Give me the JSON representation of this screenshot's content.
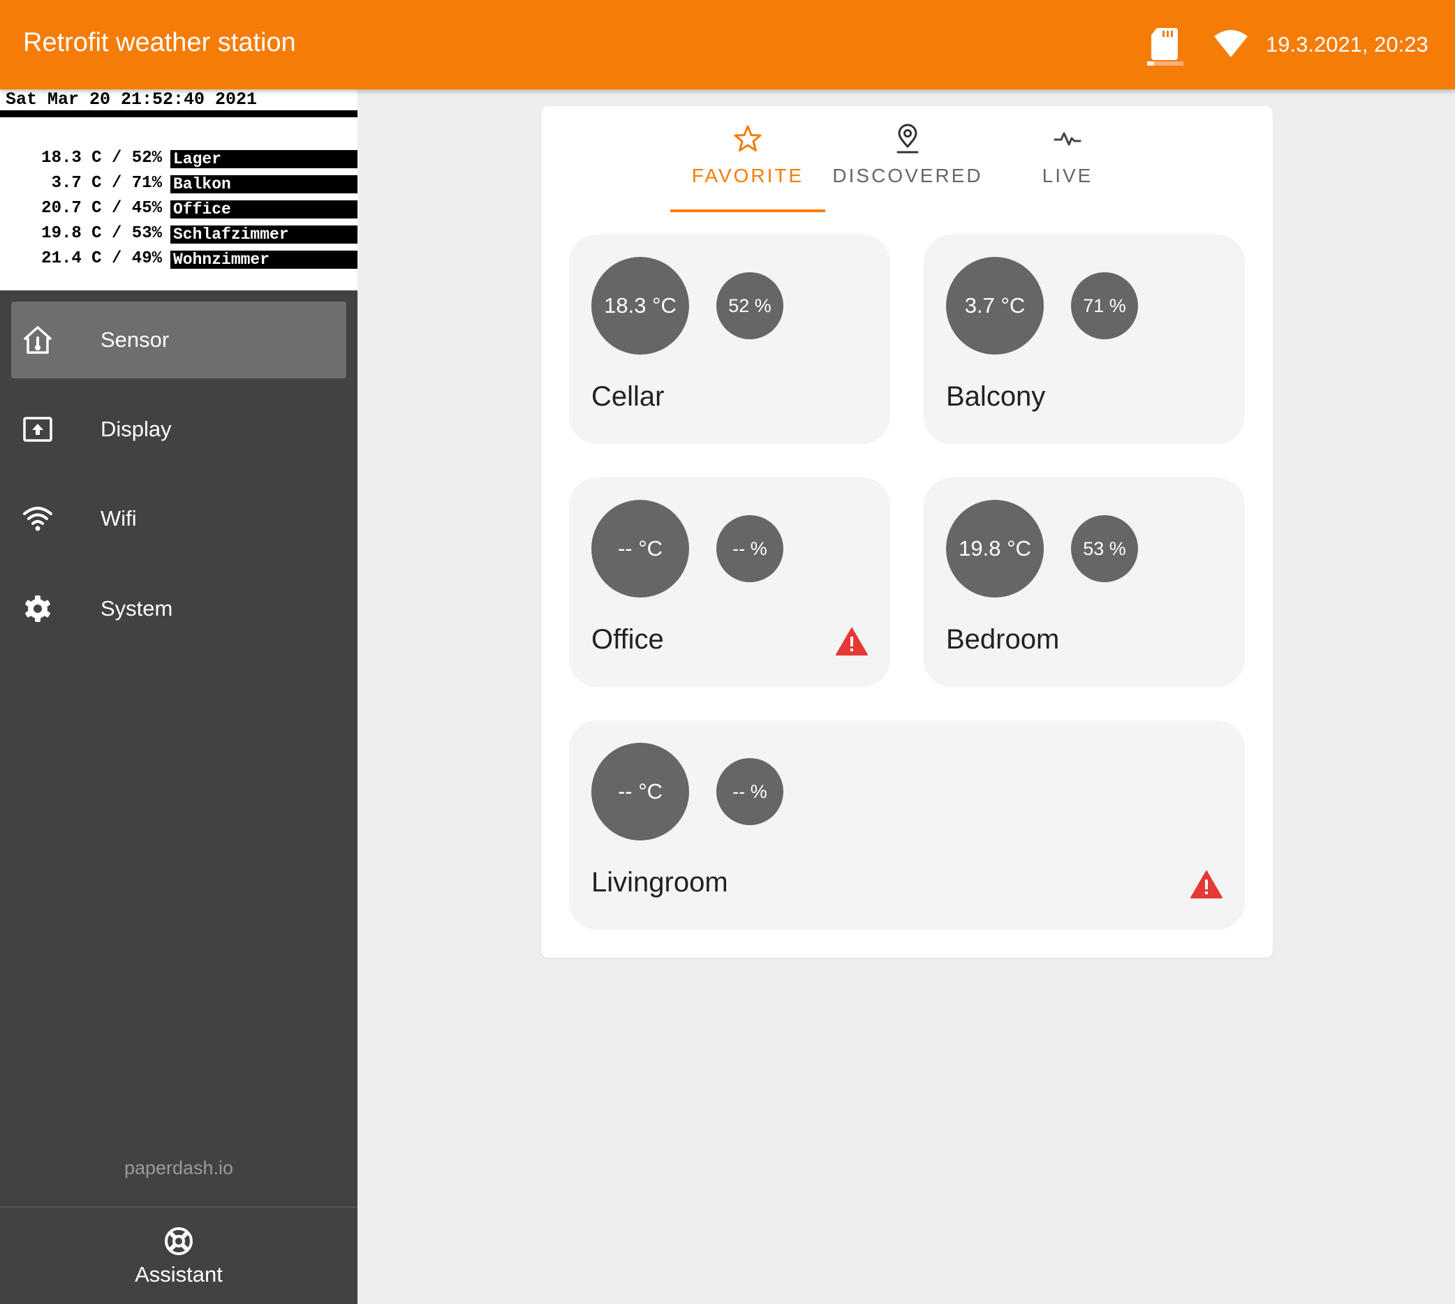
{
  "header": {
    "title": "Retrofit weather station",
    "datetime": "19.3.2021, 20:23",
    "sd_icon": "sd-card-icon",
    "wifi_icon": "wifi-icon",
    "bg_color": "#f57c07"
  },
  "eink_preview": {
    "datetime": "Sat Mar 20 21:52:40 2021",
    "rows": [
      {
        "reading": "18.3 C / 52%",
        "label": "Lager"
      },
      {
        "reading": "3.7 C / 71%",
        "label": "Balkon"
      },
      {
        "reading": "20.7 C / 45%",
        "label": "Office"
      },
      {
        "reading": "19.8 C / 53%",
        "label": "Schlafzimmer"
      },
      {
        "reading": "21.4 C / 49%",
        "label": "Wohnzimmer"
      }
    ]
  },
  "sidebar": {
    "items": [
      {
        "label": "Sensor",
        "icon": "home-thermometer-icon",
        "active": true
      },
      {
        "label": "Display",
        "icon": "display-upload-icon",
        "active": false
      },
      {
        "label": "Wifi",
        "icon": "wifi-icon",
        "active": false
      },
      {
        "label": "System",
        "icon": "gear-icon",
        "active": false
      }
    ],
    "brand": "paperdash.io",
    "assistant": {
      "label": "Assistant",
      "icon": "lifebuoy-icon"
    }
  },
  "tabs": [
    {
      "label": "FAVORITE",
      "icon": "star-icon",
      "active": true
    },
    {
      "label": "DISCOVERED",
      "icon": "map-marker-icon",
      "active": false
    },
    {
      "label": "LIVE",
      "icon": "pulse-icon",
      "active": false
    }
  ],
  "sensors": [
    {
      "name": "Cellar",
      "temperature": "18.3 °C",
      "humidity": "52 %",
      "warning": false
    },
    {
      "name": "Balcony",
      "temperature": "3.7 °C",
      "humidity": "71 %",
      "warning": false
    },
    {
      "name": "Office",
      "temperature": "-- °C",
      "humidity": "-- %",
      "warning": true
    },
    {
      "name": "Bedroom",
      "temperature": "19.8 °C",
      "humidity": "53 %",
      "warning": false
    },
    {
      "name": "Livingroom",
      "temperature": "-- °C",
      "humidity": "-- %",
      "warning": true
    }
  ],
  "colors": {
    "accent": "#f57c07",
    "warning": "#e53935",
    "sidebar_bg": "#424242",
    "bubble": "#666666"
  }
}
